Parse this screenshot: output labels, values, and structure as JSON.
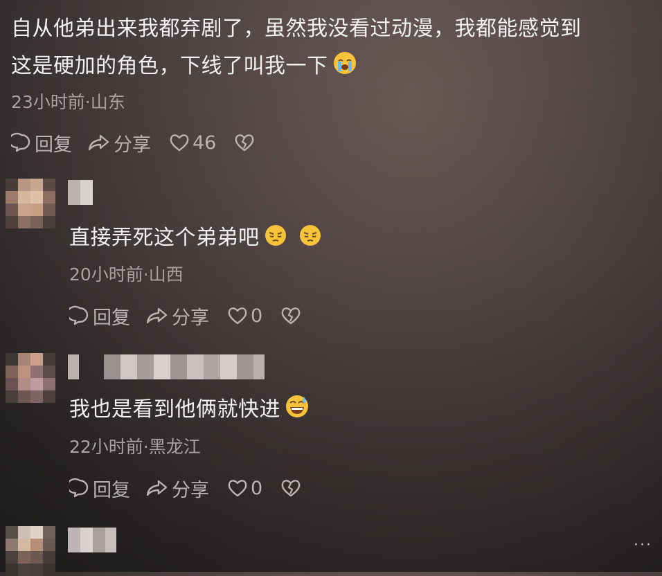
{
  "comments": [
    {
      "text_line1": "自从他弟出来我都弃剧了，虽然我没看过动漫，我都能感觉到",
      "text_line2": "这是硬加的角色，下线了叫我一下",
      "emoji": "loudly-crying-emoji",
      "meta": "23小时前·山东",
      "reply_label": "回复",
      "share_label": "分享",
      "likes": "46"
    },
    {
      "text": "直接弄死这个弟弟吧",
      "emoji": "pensive-emoji",
      "meta": "20小时前·山西",
      "reply_label": "回复",
      "share_label": "分享",
      "likes": "0"
    },
    {
      "text": "我也是看到他俩就快进",
      "emoji": "grinning-sweat-emoji",
      "meta": "22小时前·黑龙江",
      "reply_label": "回复",
      "share_label": "分享",
      "likes": "0"
    }
  ],
  "more_label": "···",
  "colors": {
    "text": "#f4f1f0",
    "meta": "#aaa2a1",
    "icon": "#bab3b2",
    "emoji_yellow": "#f6c33a"
  }
}
